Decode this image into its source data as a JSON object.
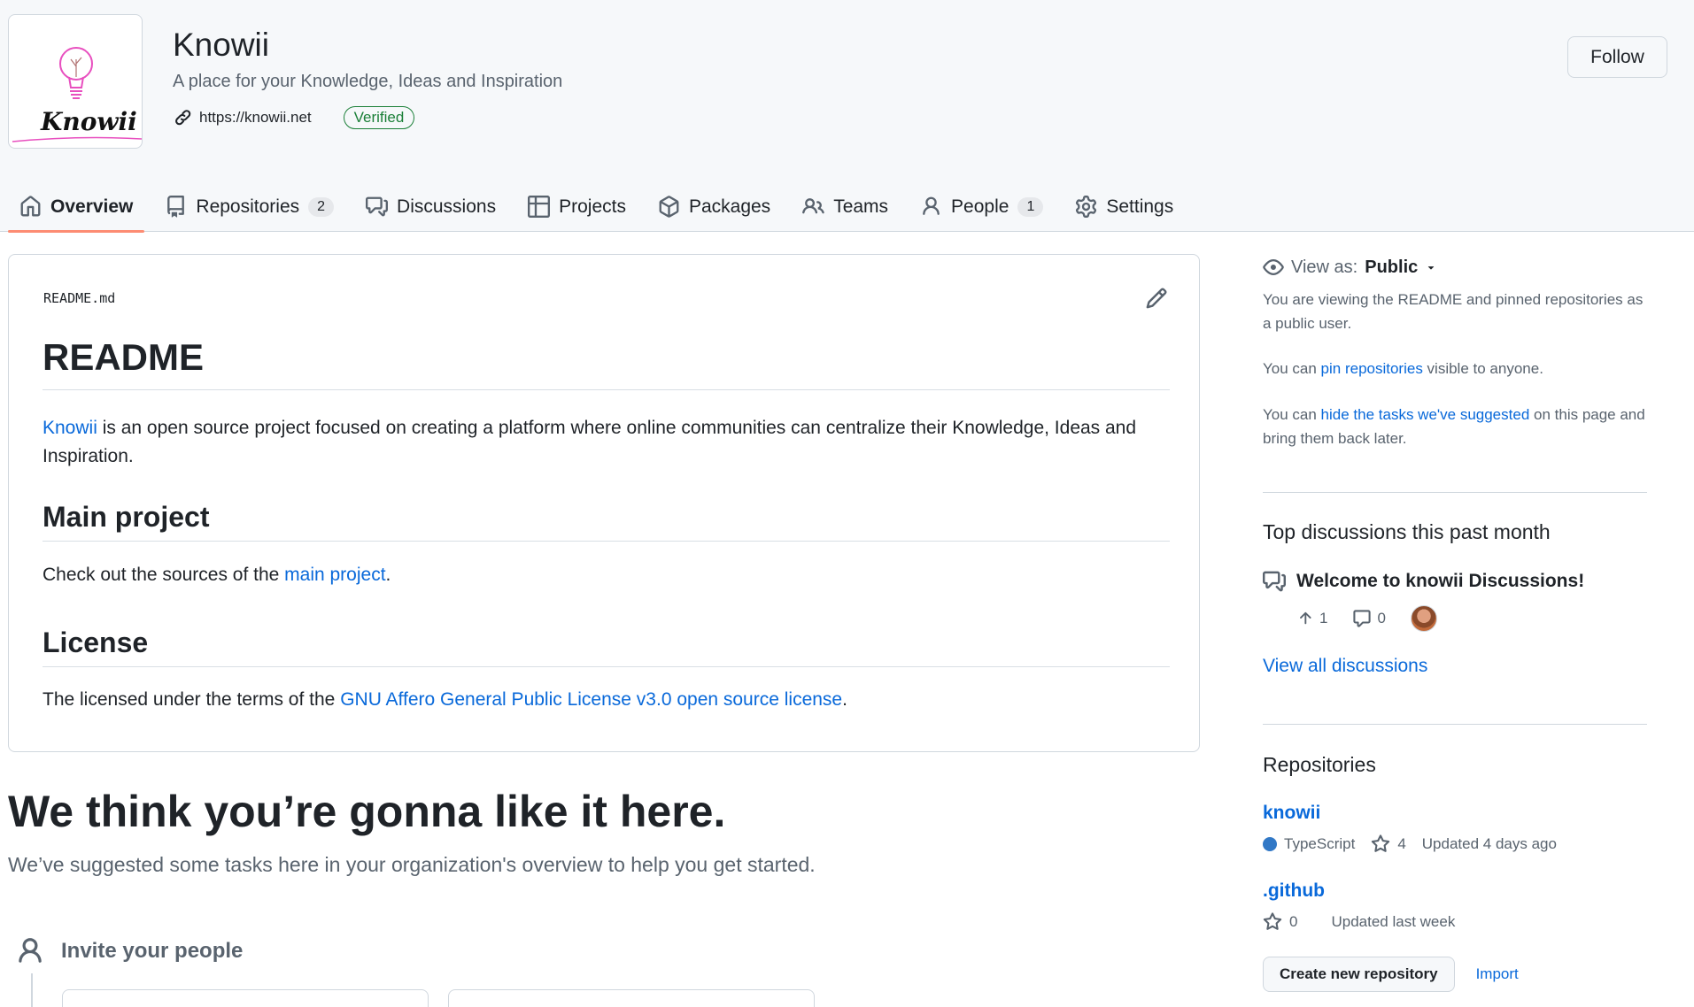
{
  "org": {
    "name": "Knowii",
    "description": "A place for your Knowledge, Ideas and Inspiration",
    "website": "https://knowii.net",
    "verified_label": "Verified",
    "logo_text": "Knowii",
    "follow_label": "Follow"
  },
  "tabs": [
    {
      "label": "Overview",
      "icon": "home-icon",
      "active": true
    },
    {
      "label": "Repositories",
      "icon": "repo-icon",
      "count": "2"
    },
    {
      "label": "Discussions",
      "icon": "discussion-icon"
    },
    {
      "label": "Projects",
      "icon": "table-icon"
    },
    {
      "label": "Packages",
      "icon": "package-icon"
    },
    {
      "label": "Teams",
      "icon": "people-icon"
    },
    {
      "label": "People",
      "icon": "person-icon",
      "count": "1"
    },
    {
      "label": "Settings",
      "icon": "gear-icon"
    }
  ],
  "readme": {
    "filename": "README.md",
    "title": "README",
    "intro_link": "Knowii",
    "intro_rest": " is an open source project focused on creating a platform where online communities can centralize their Knowledge, Ideas and Inspiration.",
    "h_main": "Main project",
    "main_prefix": "Check out the sources of the ",
    "main_link": "main project",
    "main_suffix": ".",
    "h_license": "License",
    "license_prefix": "The licensed under the terms of the ",
    "license_link": "GNU Affero General Public License v3.0 open source license",
    "license_suffix": "."
  },
  "suggest": {
    "heading": "We think you’re gonna like it here.",
    "subheading": "We’ve suggested some tasks here in your organization's overview to help you get started.",
    "invite": "Invite your people"
  },
  "sidebar": {
    "view_as_label": "View as:",
    "view_as_value": "Public",
    "viewing_text": "You are viewing the README and pinned repositories as a public user.",
    "pin_prefix": "You can ",
    "pin_link": "pin repositories",
    "pin_suffix": " visible to anyone.",
    "hide_prefix": "You can ",
    "hide_link": "hide the tasks we've suggested",
    "hide_suffix": " on this page and bring them back later.",
    "discussions_title": "Top discussions this past month",
    "discussion": {
      "title": "Welcome to knowii Discussions!",
      "upvotes": "1",
      "comments": "0"
    },
    "view_all": "View all discussions",
    "repos_title": "Repositories",
    "repos": [
      {
        "name": "knowii",
        "language": "TypeScript",
        "language_color": "#3178c6",
        "stars": "4",
        "updated": "Updated 4 days ago"
      },
      {
        "name": ".github",
        "stars": "0",
        "updated": "Updated last week"
      }
    ],
    "create_repo": "Create new repository",
    "import": "Import"
  }
}
